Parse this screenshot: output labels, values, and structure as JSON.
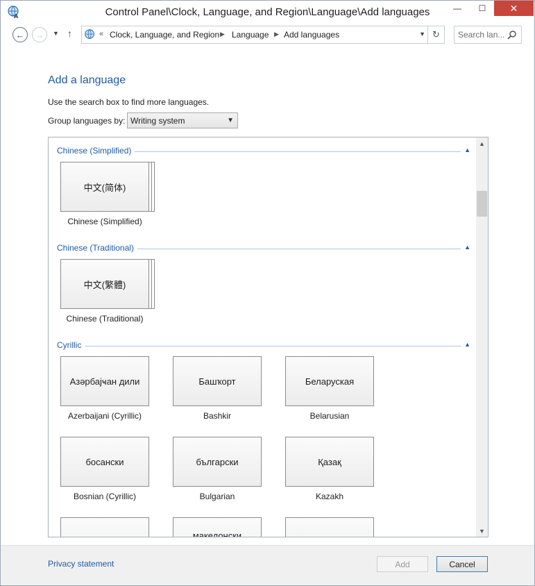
{
  "window": {
    "title": "Control Panel\\Clock, Language, and Region\\Language\\Add languages",
    "controls": {
      "minimize": "—",
      "maximize": "☐",
      "close": "✕"
    }
  },
  "address_bar": {
    "crumbs": [
      "Clock, Language, and Region",
      "Language",
      "Add languages"
    ],
    "overflow_chevron": "«",
    "search_placeholder": "Search lan..."
  },
  "content": {
    "heading": "Add a language",
    "instructions": "Use the search box to find more languages.",
    "group_by_label": "Group languages by:",
    "group_by_value": "Writing system"
  },
  "sections": [
    {
      "title": "Chinese (Simplified)",
      "tiles": [
        {
          "native": "中文(简体)",
          "label": "Chinese (Simplified)"
        }
      ]
    },
    {
      "title": "Chinese (Traditional)",
      "tiles": [
        {
          "native": "中文(繁體)",
          "label": "Chinese (Traditional)"
        }
      ]
    },
    {
      "title": "Cyrillic",
      "tiles": [
        {
          "native": "Азәрбајҹан дили",
          "label": "Azerbaijani (Cyrillic)"
        },
        {
          "native": "Башҡорт",
          "label": "Bashkir"
        },
        {
          "native": "Беларуская",
          "label": "Belarusian"
        },
        {
          "native": "босански",
          "label": "Bosnian (Cyrillic)"
        },
        {
          "native": "български",
          "label": "Bulgarian"
        },
        {
          "native": "Қазақ",
          "label": "Kazakh"
        },
        {
          "native": "",
          "label": ""
        },
        {
          "native": "македонски",
          "label": ""
        },
        {
          "native": "",
          "label": ""
        }
      ]
    }
  ],
  "footer": {
    "privacy": "Privacy statement",
    "add": "Add",
    "cancel": "Cancel"
  }
}
